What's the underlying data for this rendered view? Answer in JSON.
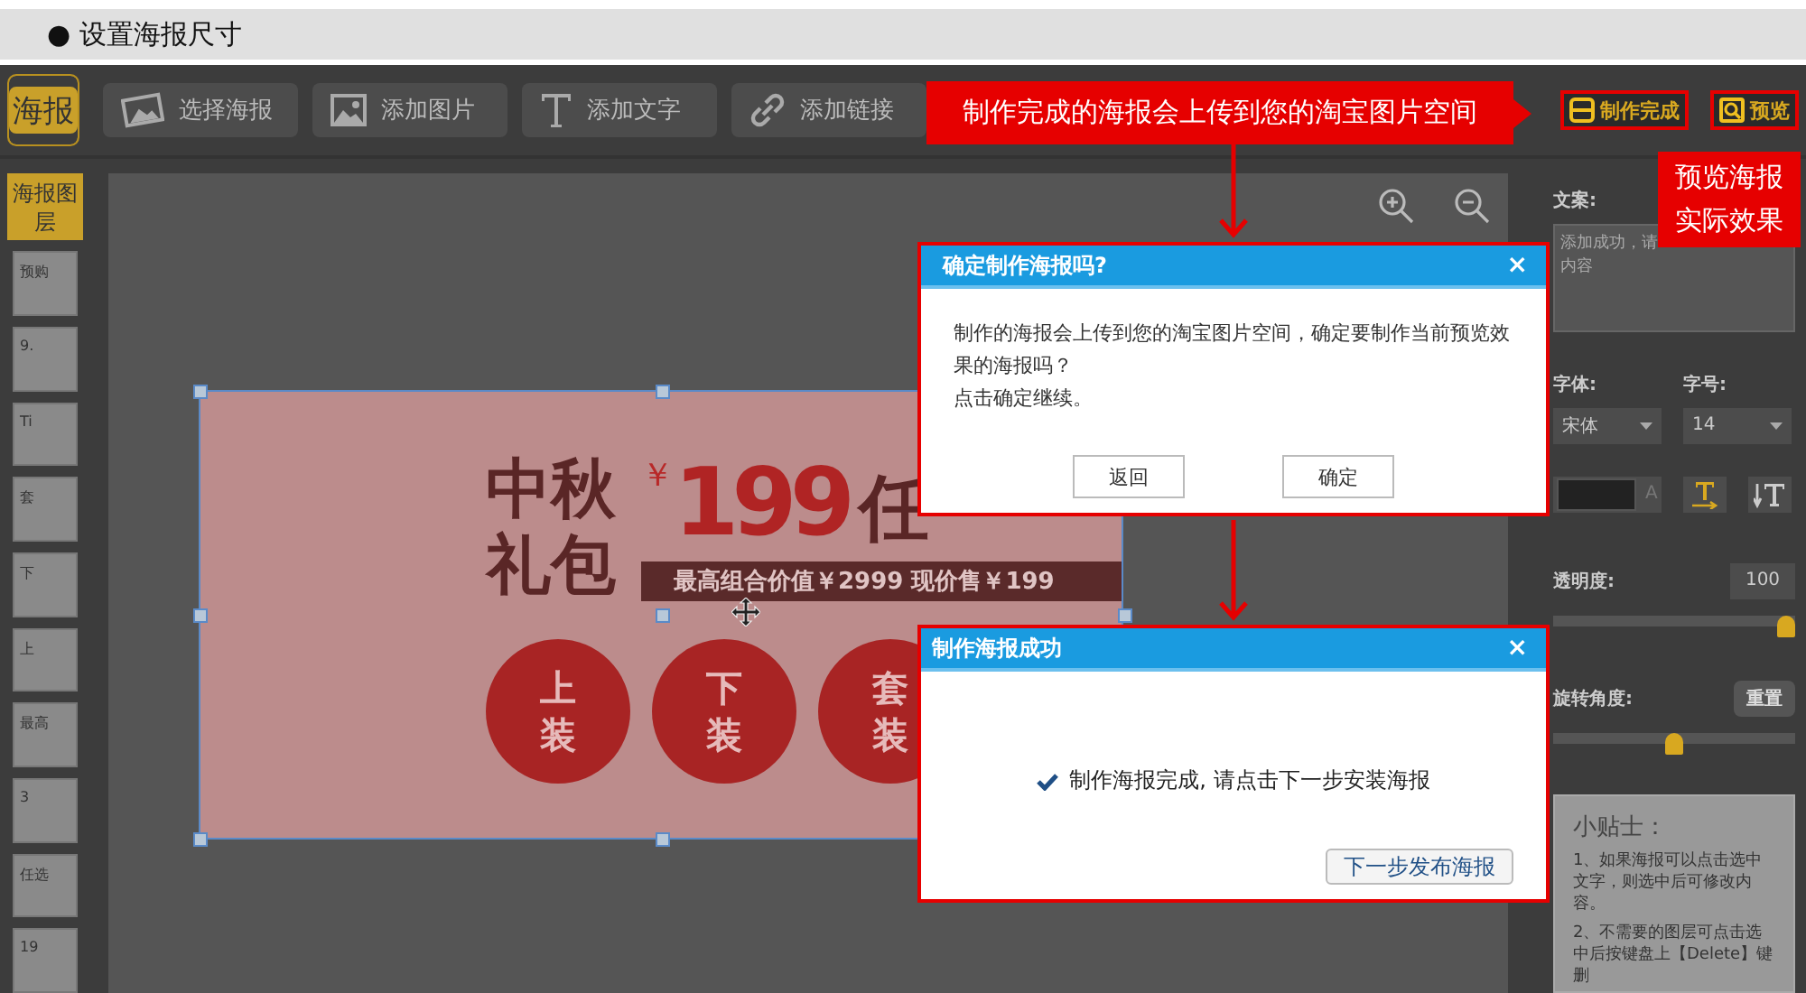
{
  "header": {
    "title": "● 设置海报尺寸"
  },
  "toolbar": {
    "logo": "海报",
    "buttons": [
      {
        "label": "选择海报",
        "kind": "poster"
      },
      {
        "label": "添加图片",
        "kind": "image"
      },
      {
        "label": "添加文字",
        "kind": "text"
      },
      {
        "label": "添加链接",
        "kind": "link"
      }
    ],
    "actions": [
      {
        "label": "制作完成",
        "kind": "save",
        "highlighted": true
      },
      {
        "label": "预览",
        "kind": "preview",
        "highlighted": true
      }
    ]
  },
  "layers": {
    "title": "海报图层",
    "items": [
      "预购",
      "9.",
      "Ti",
      "套",
      "下",
      "上",
      "最高",
      "3",
      "任选",
      "19"
    ]
  },
  "poster": {
    "title_lines": [
      "中秋",
      "礼包"
    ],
    "currency": "￥",
    "price": "199",
    "offer": "任",
    "subline": "最高组合价值￥2999  现价售￥199",
    "circles": [
      "上装",
      "下装",
      "套装"
    ]
  },
  "properties": {
    "copy_label": "文案:",
    "copy_lines": [
      "添加成功，请",
      "内容"
    ],
    "font_label": "字体:",
    "font_value": "宋体",
    "size_label": "字号:",
    "size_value": "14",
    "color_letter": "A",
    "opacity_label": "透明度:",
    "opacity_value": "100",
    "opacity": {
      "level": 1.0
    },
    "rotation_label": "旋转角度:",
    "reset_button": "重置",
    "rotation": {
      "level": 0.5
    },
    "tips_title": "小贴士：",
    "tips": [
      "1、如果海报可以点击选中文字，则选中后可修改内容。",
      "2、不需要的图层可点击选中后按键盘上【Delete】键删"
    ]
  },
  "callouts": [
    {
      "text": "制作完成的海报会上传到您的淘宝图片空间",
      "kind": "top"
    },
    {
      "text": "预览海报实际效果",
      "kind": "preview"
    }
  ],
  "dialogs": [
    {
      "title": "确定制作海报吗?",
      "close": "×",
      "kind": "confirm",
      "lines": [
        "制作的海报会上传到您的淘宝图片空间，确定要制作当前预览效果的海报吗？",
        "点击确定继续。"
      ],
      "buttons": [
        "返回",
        "确定"
      ]
    },
    {
      "title": "制作海报成功",
      "close": "×",
      "kind": "success",
      "lines": [
        "制作海报完成, 请点击下一步安装海报"
      ],
      "buttons": [
        "下一步发布海报"
      ]
    }
  ]
}
